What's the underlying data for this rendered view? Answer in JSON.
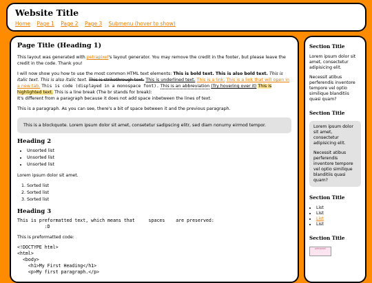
{
  "header": {
    "title": "Website Title",
    "nav": [
      "Home",
      "Page 1",
      "Page 2",
      "Page 3",
      "Submenu (hover to show)"
    ]
  },
  "main": {
    "h1": "Page Title (Heading 1)",
    "intro_pre": "This layout was generated with ",
    "intro_link": "petrapixel",
    "intro_post": "'s layout generator. You may remove the credit in the footer, but please leave the credit in the code. Thank you!",
    "p2_pre": "I will now show you how to use the most common HTML text elements: ",
    "bold1": "This is bold text.",
    "bold2": "This is also bold text.",
    "italic1": "This is italic text.",
    "italic2": "This is also italic text.",
    "strike": "This is strikethrough text.",
    "underline": "This is underlined text.",
    "link1": "This is a link.",
    "link2": "This is a link that will open in a new tab.",
    "code_text": "This is code (displayed in a monospace font).",
    "abbr": "This is an abbreviation",
    "abbr_hint": "(Try hovering over it)",
    "highlight": "This is highlighted text.",
    "line_break": "This is a line break (The br stands for break):",
    "new_line": "It's different from a paragraph because it does not add space inbetween the lines of text.",
    "p3": "This is a paragraph. As you can see, there's a bit of space between it and the previous paragraph.",
    "blockquote": "This is a blockquote. Lorem ipsum dolor sit amet, consetetur sadipscing elitr, sed diam nonumy eirmod tempor.",
    "h2": "Heading 2",
    "ul": [
      "Unsorted list",
      "Unsorted list",
      "Unsorted list"
    ],
    "lorem": "Lorem ipsum dolor sit amet.",
    "ol": [
      "Sorted list",
      "Sorted list",
      "Sorted list"
    ],
    "h3": "Heading 3",
    "pre1": "This is preformatted text, which means that     spaces    are preserved:\n          :D",
    "pre_code_label": "This is preformatted code:",
    "pre2": "<!DOCTYPE html>\n<html>\n  <body>\n    <h1>My First Heading</h1>\n    <p>My first paragraph.</p>"
  },
  "sidebar": {
    "s1_title": "Section Title",
    "s1_p1": "Lorem ipsum dolor sit amet, consectetur adipisicing elit.",
    "s1_p2": "Necessit atibus perferendis inventore tempore vel optio similique blanditiis quasi quam?",
    "s2_title": "Section Title",
    "s2_p1": "Lorem ipsum dolor sit amet, consectetur adipisicing elit.",
    "s2_p2": "Necessit atibus perferendis inventore tempore vel optio similique blanditiis quasi quam?",
    "s3_title": "Section Title",
    "list": [
      "List",
      "List",
      "List",
      "List"
    ],
    "s4_title": "Section Title",
    "badge_text": "petrapixel"
  }
}
